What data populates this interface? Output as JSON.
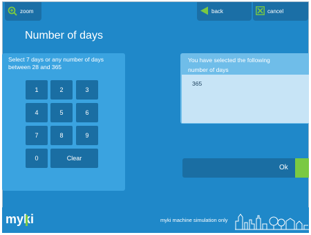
{
  "toolbar": {
    "zoom_label": "zoom",
    "back_label": "back",
    "cancel_label": "cancel"
  },
  "page": {
    "title": "Number of days"
  },
  "instruction": {
    "line1": "Select 7 days or any number of days",
    "line2": "between 28  and 365"
  },
  "keypad": {
    "keys": [
      "1",
      "2",
      "3",
      "4",
      "5",
      "6",
      "7",
      "8",
      "9",
      "0"
    ],
    "clear_label": "Clear"
  },
  "selection": {
    "label_line1": "You have selected the following",
    "label_line2": "number of days",
    "value": "365"
  },
  "ok_label": "Ok",
  "footer": {
    "logo_text": "myki",
    "note": "myki machine simulation only"
  },
  "colors": {
    "background": "#1f88c9",
    "panel": "#3aa3e0",
    "button": "#1a6ea3",
    "accent_green": "#7ac943"
  }
}
